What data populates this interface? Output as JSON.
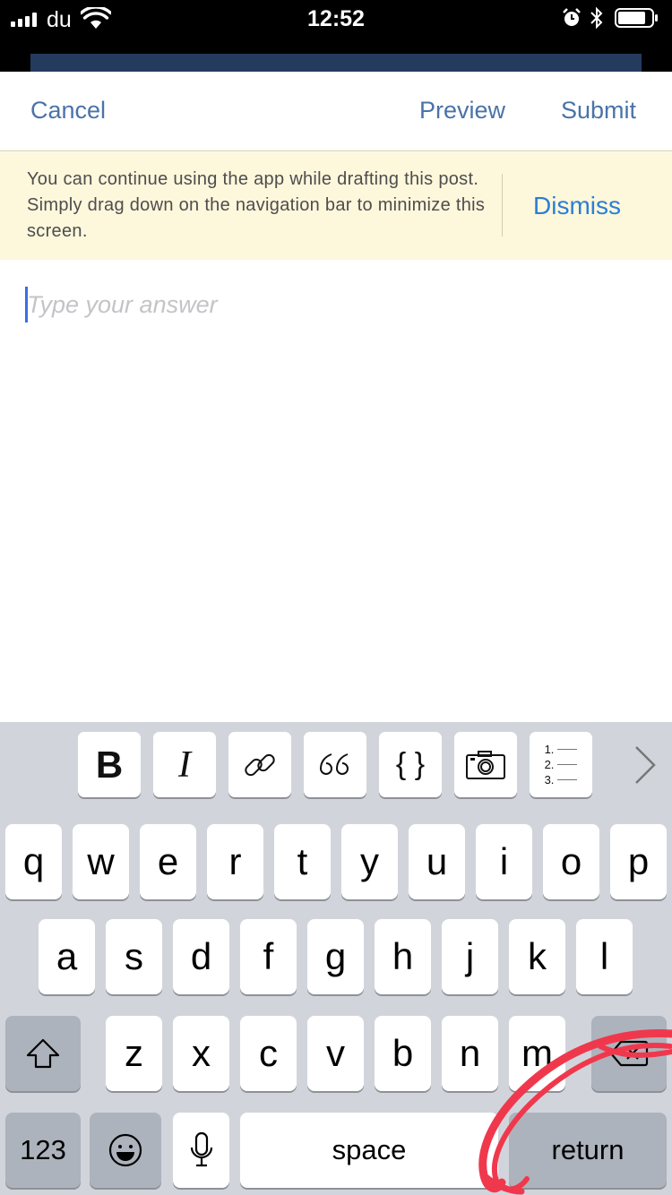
{
  "status_bar": {
    "carrier": "du",
    "time": "12:52"
  },
  "nav": {
    "cancel": "Cancel",
    "preview": "Preview",
    "submit": "Submit"
  },
  "banner": {
    "text": "You can continue using the app while drafting this post. Simply drag down on the navigation bar to minimize this screen.",
    "dismiss": "Dismiss"
  },
  "editor": {
    "placeholder": "Type your answer"
  },
  "toolbar": {
    "items": [
      "bold-icon",
      "italic-icon",
      "link-icon",
      "quote-icon",
      "code-icon",
      "camera-icon",
      "numbered-list-icon",
      "chevron-right-icon"
    ],
    "bold": "B",
    "italic": "I",
    "code": "{ }",
    "list_numbers": [
      "1.",
      "2.",
      "3."
    ]
  },
  "keyboard": {
    "row1": [
      "q",
      "w",
      "e",
      "r",
      "t",
      "y",
      "u",
      "i",
      "o",
      "p"
    ],
    "row2": [
      "a",
      "s",
      "d",
      "f",
      "g",
      "h",
      "j",
      "k",
      "l"
    ],
    "row3": [
      "z",
      "x",
      "c",
      "v",
      "b",
      "n",
      "m"
    ],
    "numbers": "123",
    "space": "space",
    "return": "return",
    "icons": [
      "shift-icon",
      "delete-icon",
      "emoji-icon",
      "microphone-icon"
    ]
  },
  "colors": {
    "accent": "#4a73a8",
    "dismiss": "#2b7ed4",
    "banner_bg": "#fdf7dc",
    "keyboard_bg": "#d1d5db",
    "annotation": "#f0384d"
  }
}
